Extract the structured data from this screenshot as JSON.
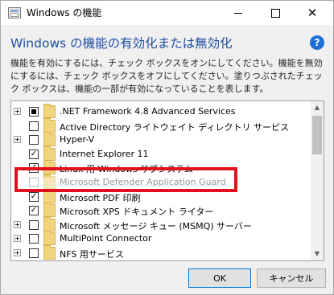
{
  "window": {
    "title": "Windows の機能",
    "app_icon": "windows-features-icon"
  },
  "header": {
    "heading": "Windows の機能の有効化または無効化",
    "help_label": "?",
    "description": "機能を有効にするには、チェック ボックスをオンにしてください。機能を無効にするには、チェック ボックスをオフにしてください。塗りつぶされたチェック ボックスは、機能の一部が有効になっていることを表します。"
  },
  "features": [
    {
      "label": ".NET Framework 4.8 Advanced Services",
      "state": "partial",
      "expandable": true,
      "enabled": true
    },
    {
      "label": "Active Directory ライトウェイト ディレクトリ サービス",
      "state": "unchecked",
      "expandable": false,
      "enabled": true
    },
    {
      "label": "Hyper-V",
      "state": "unchecked",
      "expandable": true,
      "enabled": true
    },
    {
      "label": "Internet Explorer 11",
      "state": "checked",
      "expandable": false,
      "enabled": true
    },
    {
      "label": "Linux 用 Windows サブシステム",
      "state": "checked",
      "expandable": false,
      "enabled": true
    },
    {
      "label": "Microsoft Defender Application Guard",
      "state": "unchecked",
      "expandable": false,
      "enabled": false
    },
    {
      "label": "Microsoft PDF 印刷",
      "state": "checked",
      "expandable": false,
      "enabled": true
    },
    {
      "label": "Microsoft XPS ドキュメント ライター",
      "state": "checked",
      "expandable": false,
      "enabled": true
    },
    {
      "label": "Microsoft メッセージ キュー (MSMQ) サーバー",
      "state": "unchecked",
      "expandable": true,
      "enabled": true
    },
    {
      "label": "MultiPoint Connector",
      "state": "unchecked",
      "expandable": true,
      "enabled": true
    },
    {
      "label": "NFS 用サービス",
      "state": "unchecked",
      "expandable": true,
      "enabled": true
    }
  ],
  "buttons": {
    "ok": "OK",
    "cancel": "キャンセル"
  },
  "colors": {
    "heading": "#1e4fa3",
    "highlight_border": "#e0101c",
    "folder": "#f2d37e"
  }
}
